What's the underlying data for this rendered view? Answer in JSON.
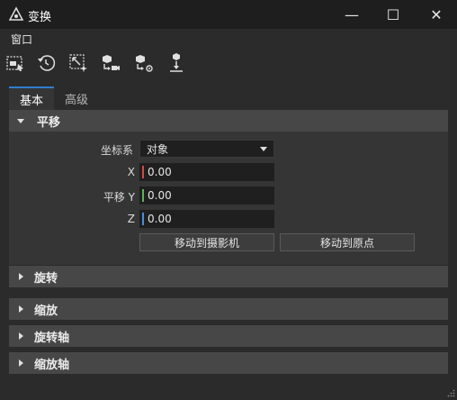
{
  "window": {
    "title": "变换",
    "minimize_glyph": "—",
    "maximize_glyph": "☐",
    "close_glyph": "✕"
  },
  "menu": {
    "items": [
      "窗口"
    ]
  },
  "toolbar": {
    "icons": [
      "select-transform-icon",
      "reset-rotation-icon",
      "scale-select-icon",
      "move-object-to-camera-icon",
      "move-object-to-origin-icon",
      "place-on-ground-icon"
    ]
  },
  "tabs": [
    {
      "label": "基本",
      "active": true
    },
    {
      "label": "高级",
      "active": false
    }
  ],
  "sections": {
    "translate": {
      "label": "平移",
      "expanded": true
    },
    "rotate": {
      "label": "旋转",
      "expanded": false
    },
    "scale": {
      "label": "缩放",
      "expanded": false
    },
    "rotate_axis": {
      "label": "旋转轴",
      "expanded": false
    },
    "scale_axis": {
      "label": "缩放轴",
      "expanded": false
    }
  },
  "translate": {
    "coord_label": "坐标系",
    "coord_value": "对象",
    "x_label": "X",
    "y_label": "平移 Y",
    "z_label": "Z",
    "x_value": "0.00",
    "y_value": "0.00",
    "z_value": "0.00",
    "move_to_camera": "移动到摄影机",
    "move_to_origin": "移动到原点"
  },
  "colors": {
    "x_axis": "#d24a4a",
    "y_axis": "#5fb35f",
    "z_axis": "#4a8fd6",
    "accent": "#2f7fd0"
  }
}
